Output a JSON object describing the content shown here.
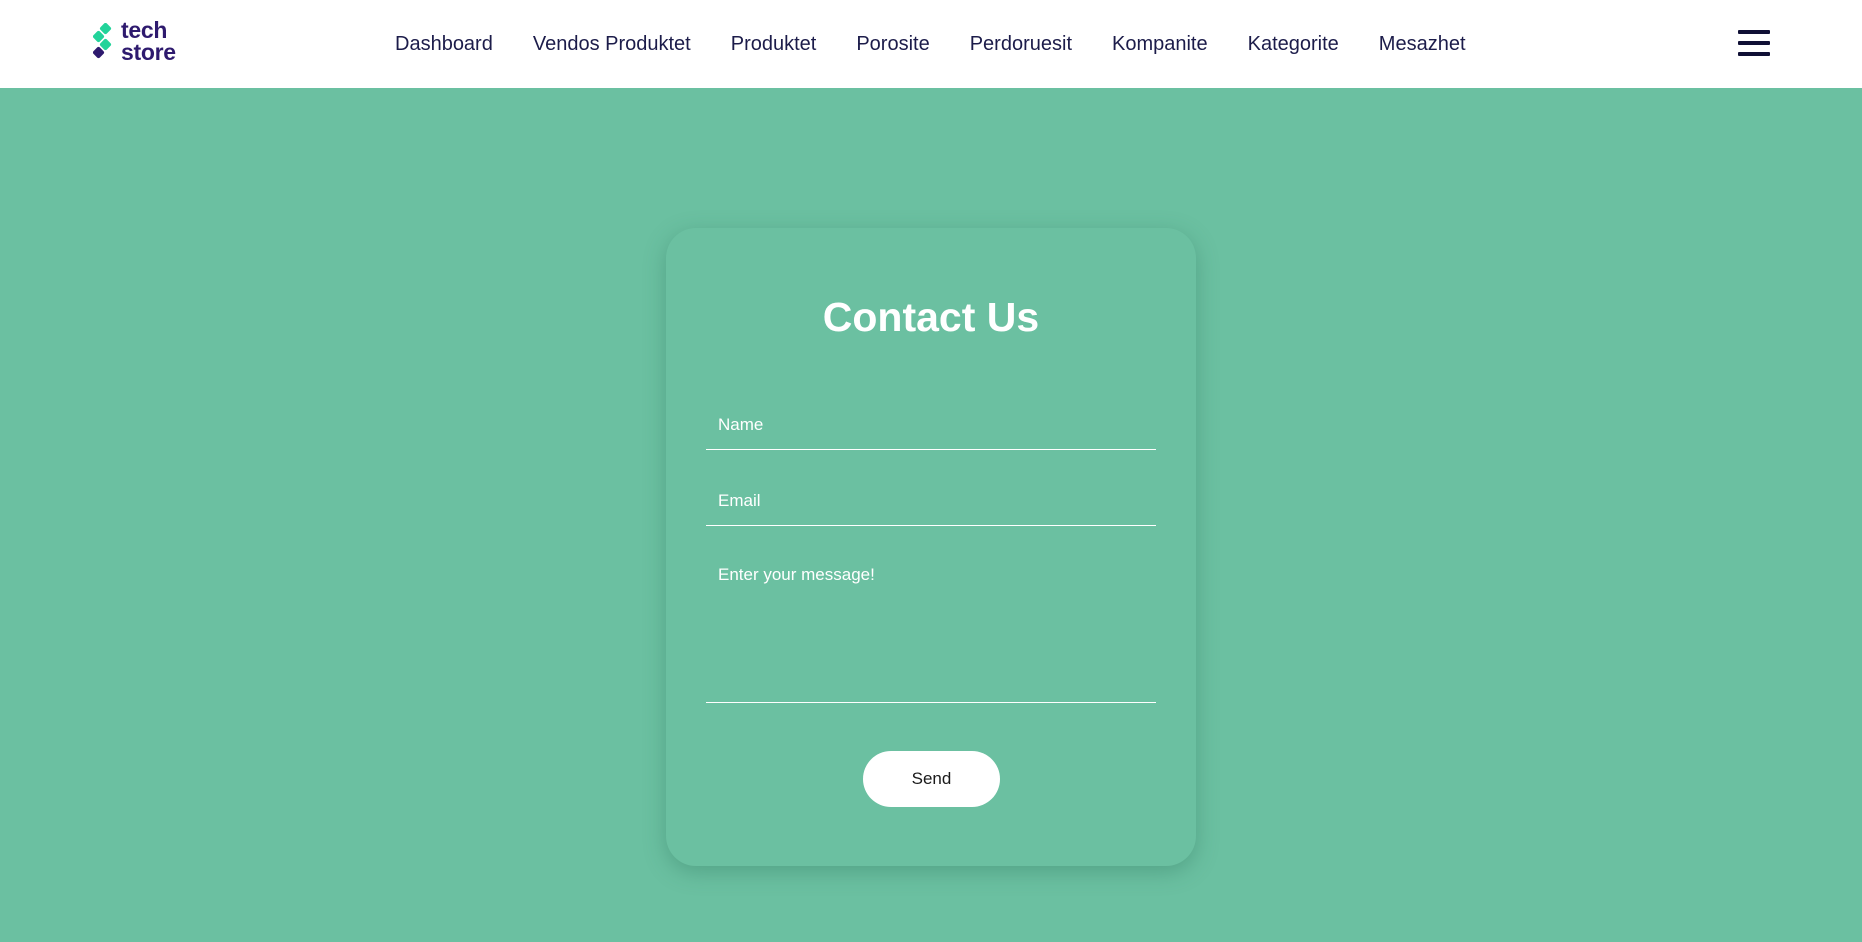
{
  "brand": {
    "logo_line1": "tech",
    "logo_line2": "store",
    "primary_color": "#2e1a6e",
    "accent_color": "#22d39a"
  },
  "nav": {
    "links": [
      {
        "label": "Dashboard"
      },
      {
        "label": "Vendos Produktet"
      },
      {
        "label": "Produktet"
      },
      {
        "label": "Porosite"
      },
      {
        "label": "Perdoruesit"
      },
      {
        "label": "Kompanite"
      },
      {
        "label": "Kategorite"
      },
      {
        "label": "Mesazhet"
      }
    ],
    "menu_icon": "hamburger-menu-icon"
  },
  "contact_form": {
    "title": "Contact Us",
    "name_placeholder": "Name",
    "email_placeholder": "Email",
    "message_placeholder": "Enter your message!",
    "name_value": "",
    "email_value": "",
    "message_value": "",
    "send_label": "Send"
  },
  "colors": {
    "page_background": "#6bc0a1",
    "nav_background": "#ffffff",
    "nav_text": "#1c1c4a"
  }
}
